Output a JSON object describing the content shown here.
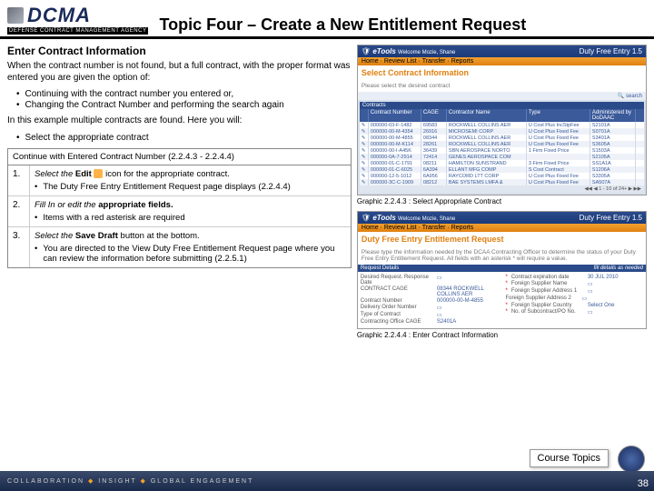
{
  "header": {
    "logo_main": "DCMA",
    "logo_sub": "DEFENSE CONTRACT MANAGEMENT AGENCY",
    "topic": "Topic Four – Create a New Entitlement Request"
  },
  "subtitle": "Enter Contract Information",
  "intro": "When the contract number is not found, but a full contract, with the proper format was entered you are given the option of:",
  "opts": [
    "Continuing with the contract number you entered or,",
    "Changing the Contract Number and performing the search again"
  ],
  "example_line": "In this example multiple contracts are found. Here you will:",
  "select_bullet": "Select the appropriate contract",
  "table": {
    "head": "Continue with Entered Contract Number (2.2.4.3 - 2.2.4.4)",
    "rows": [
      {
        "num": "1.",
        "main_prefix": "Select the ",
        "main_bold1": "Edit",
        "main_suffix": "   icon for the appropriate contract.",
        "sub": "The Duty Free Entry Entitlement Request page displays (2.2.4.4)"
      },
      {
        "num": "2.",
        "main_prefix": "Fill In or edit the ",
        "main_bold1": "appropriate fields.",
        "main_suffix": "",
        "sub": "Items with a red asterisk are required"
      },
      {
        "num": "3.",
        "main_prefix": "Select the ",
        "main_bold1": "Save Draft",
        "main_suffix": " button at the bottom.",
        "sub": "You are directed to the View Duty Free Entitlement Request page where you can review the information before submitting (2.2.5.1)"
      }
    ]
  },
  "ss1": {
    "brand": "eTools",
    "app": "Duty Free Entry 1.5",
    "welcome": "Welcome Mozie, Shane",
    "nav": "Home · Review List · Transfer · Reports",
    "title": "Select Contract Information",
    "sub": "Please select the desired contract",
    "search": "search",
    "panel": "Contracts",
    "cols": [
      "Contract Number",
      "CAGE",
      "Contractor Name",
      "Type",
      "Administered by DoDAAC"
    ],
    "rows": [
      [
        "000000-03-F-1482",
        "69583",
        "ROCKWELL COLLINS AER",
        "U Cost Plus IncStpFee",
        "S2101A"
      ],
      [
        "000000-00-M-4354",
        "26916",
        "MICROSEMI CORP",
        "U Cost Plus Fixed Fee",
        "S0701A"
      ],
      [
        "000000-00-M-4855",
        "08344",
        "ROCKWELL COLLINS AER",
        "U Cost Plus Fixed Fee",
        "S3401A"
      ],
      [
        "000000-00-M-K114",
        "28261",
        "ROCKWELL COLLINS AER",
        "U Cost Plus Fixed Fee",
        "S3605A"
      ],
      [
        "000000-00-I-A45K",
        "36439",
        "SBN AEROSPACE NORTO",
        "1 Firm Fixed Price",
        "S1503A"
      ],
      [
        "000000-0A-7-2914",
        "72414",
        "GENES AEROSPACE COM",
        "",
        "S2105A"
      ],
      [
        "000000-01-C-1791",
        "08211",
        "HAMILTON SUNSTRAND",
        "3 Firm Fixed Price",
        "SS1A1A"
      ],
      [
        "000000-01-C-6025",
        "6A394",
        "ELLANT MFG COMP",
        "S Cost Contract",
        "S1206A"
      ],
      [
        "000000-12-5-1012",
        "6A956",
        "RAYCORD LTT CORP",
        "U Cost Plus Fixed Fee",
        "S3305A"
      ],
      [
        "000000-3C-C-1909",
        "08212",
        "BAE SYSTEMS LMFA &",
        "U Cost Plus Fixed Fee",
        "SA507A"
      ]
    ],
    "pager": "1 - 10 of 24+",
    "caption": "Graphic 2.2.4.3 : Select Appropriate Contract"
  },
  "ss2": {
    "brand": "eTools",
    "app": "Duty Free Entry 1.5",
    "welcome": "Welcome Mozie, Shane",
    "nav": "Home · Review List · Transfer · Reports",
    "title": "Duty Free Entry Entitlement Request",
    "desc": "Please type the information needed by the DCAA Contracting Officer to determine the status of your Duty Free Entry Entitlement Request. All fields with an asterisk * will require a value.",
    "panel": "Request Details",
    "hint": "fill details as needed",
    "fields": {
      "desired_label": "Desired Request. Response Date",
      "cage_label": "CONTRACT CAGE",
      "cage_val": "08344 ROCKWELL COLLINS AER",
      "expire_label": "Contract expiration date",
      "expire_val": "30 JUL 2010",
      "cnum_label": "Contract Number",
      "cnum_val": "000000-00-M-4855",
      "fname_label": "Foreign Supplier Name",
      "deliv_label": "Delivery Order Number",
      "faddr1_label": "Foreign Supplier Address 1",
      "faddr2_label": "Foreign Supplier Address 2",
      "type_label": "Type of Contract",
      "country_label": "Foreign Supplier Country",
      "country_val": "Select One",
      "ccage_label": "Contracting Office CAGE",
      "ccage_val": "S2401A",
      "subc_label": "No. of Subcontract/PO No."
    },
    "caption": "Graphic 2.2.4.4 : Enter Contract Information"
  },
  "course_btn": "Course Topics",
  "footer": {
    "t1": "COLLABORATION",
    "t2": "INSIGHT",
    "t3": "GLOBAL ENGAGEMENT"
  },
  "pagenum": "38"
}
